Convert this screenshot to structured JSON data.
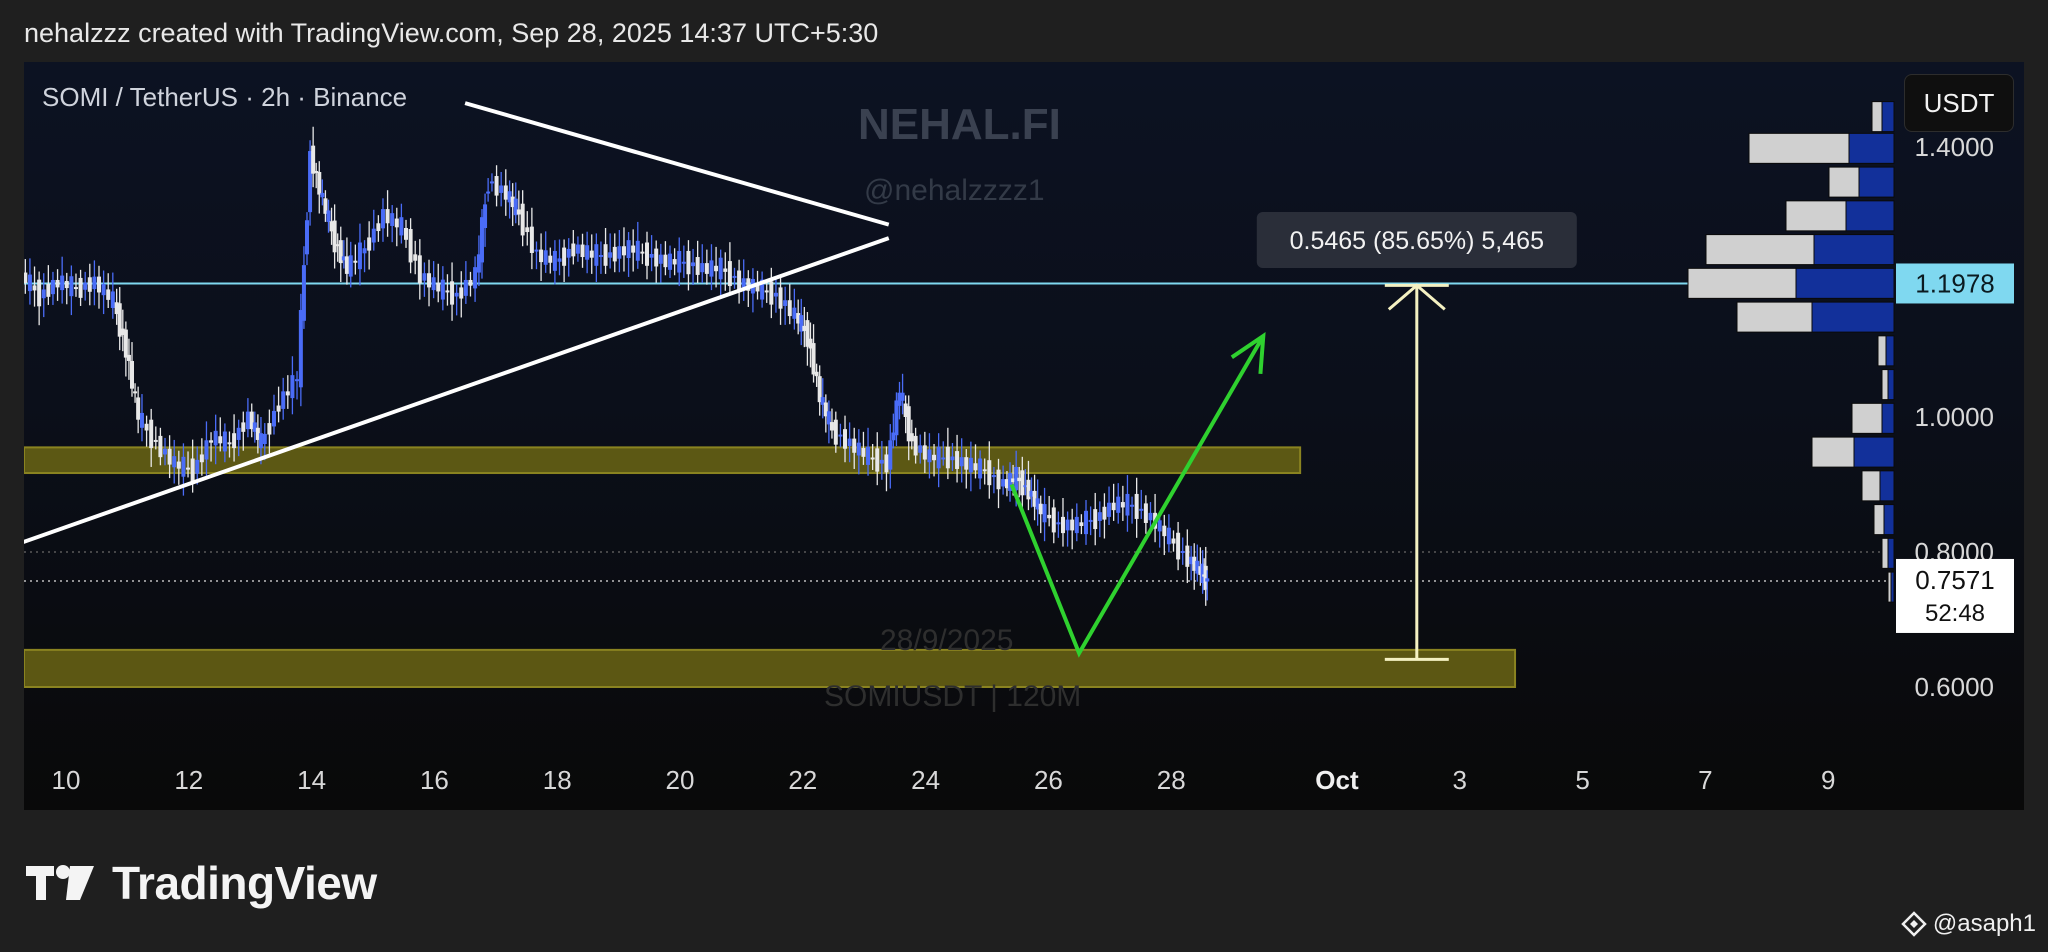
{
  "header": {
    "credit": "nehalzzz created with TradingView.com, Sep 28, 2025 14:37 UTC+5:30"
  },
  "symbol_info": "SOMI / TetherUS · 2h · Binance",
  "watermark": {
    "title": "NEHAL.FI",
    "handle": "@nehalzzzz1",
    "date": "28/9/2025",
    "symbol": "SOMIUSDT | 120M"
  },
  "toolbar": {
    "currency": "USDT"
  },
  "footer": {
    "brand": "TradingView",
    "attribution": "@asaph1"
  },
  "colors": {
    "bull": "#4a6cf7",
    "bear": "#e8e8e8",
    "zone": "#6b6514",
    "green_arrow": "#2fd12f",
    "hline": "#7fd8f0",
    "measure": "#f4f1c2",
    "vp_buy": "#12309a",
    "vp_sell": "#d0d0d0"
  },
  "chart_data": {
    "type": "candlestick",
    "x_ticks": [
      "10",
      "12",
      "14",
      "16",
      "18",
      "20",
      "22",
      "24",
      "26",
      "28",
      "Oct",
      "3",
      "5",
      "7",
      "9"
    ],
    "y_ticks": [
      "1.4000",
      "1.0000",
      "0.8000",
      "0.6000"
    ],
    "ylim": [
      0.52,
      1.48
    ],
    "grid": false,
    "close_series": [
      [
        9.1,
        1.25
      ],
      [
        9.3,
        1.21
      ],
      [
        9.6,
        1.18
      ],
      [
        9.9,
        1.2
      ],
      [
        10.2,
        1.19
      ],
      [
        10.5,
        1.2
      ],
      [
        10.8,
        1.17
      ],
      [
        11.0,
        1.1
      ],
      [
        11.2,
        1.0
      ],
      [
        11.5,
        0.96
      ],
      [
        11.8,
        0.93
      ],
      [
        12.1,
        0.92
      ],
      [
        12.4,
        0.97
      ],
      [
        12.7,
        0.96
      ],
      [
        13.0,
        1.0
      ],
      [
        13.2,
        0.96
      ],
      [
        13.5,
        1.02
      ],
      [
        13.8,
        1.06
      ],
      [
        14.0,
        1.39
      ],
      [
        14.2,
        1.32
      ],
      [
        14.4,
        1.26
      ],
      [
        14.6,
        1.22
      ],
      [
        14.9,
        1.25
      ],
      [
        15.2,
        1.3
      ],
      [
        15.5,
        1.28
      ],
      [
        15.8,
        1.21
      ],
      [
        16.1,
        1.19
      ],
      [
        16.4,
        1.18
      ],
      [
        16.7,
        1.21
      ],
      [
        16.9,
        1.35
      ],
      [
        17.2,
        1.33
      ],
      [
        17.4,
        1.3
      ],
      [
        17.7,
        1.24
      ],
      [
        18.0,
        1.23
      ],
      [
        18.3,
        1.25
      ],
      [
        18.6,
        1.24
      ],
      [
        18.9,
        1.24
      ],
      [
        19.2,
        1.25
      ],
      [
        19.5,
        1.24
      ],
      [
        19.8,
        1.23
      ],
      [
        20.1,
        1.23
      ],
      [
        20.4,
        1.22
      ],
      [
        20.7,
        1.22
      ],
      [
        21.0,
        1.2
      ],
      [
        21.3,
        1.19
      ],
      [
        21.6,
        1.18
      ],
      [
        21.9,
        1.15
      ],
      [
        22.1,
        1.12
      ],
      [
        22.3,
        1.03
      ],
      [
        22.5,
        0.98
      ],
      [
        22.8,
        0.96
      ],
      [
        23.1,
        0.94
      ],
      [
        23.4,
        0.93
      ],
      [
        23.6,
        1.04
      ],
      [
        23.8,
        0.96
      ],
      [
        24.1,
        0.94
      ],
      [
        24.4,
        0.94
      ],
      [
        24.7,
        0.93
      ],
      [
        25.0,
        0.92
      ],
      [
        25.3,
        0.9
      ],
      [
        25.5,
        0.91
      ],
      [
        25.7,
        0.89
      ],
      [
        25.9,
        0.86
      ],
      [
        26.2,
        0.84
      ],
      [
        26.5,
        0.84
      ],
      [
        26.8,
        0.85
      ],
      [
        27.1,
        0.87
      ],
      [
        27.4,
        0.87
      ],
      [
        27.7,
        0.85
      ],
      [
        28.0,
        0.82
      ],
      [
        28.3,
        0.79
      ],
      [
        28.5,
        0.77
      ],
      [
        28.6,
        0.757
      ]
    ],
    "trendlines": [
      {
        "x1": 9.0,
        "y1": 0.805,
        "x2": 23.4,
        "y2": 1.265
      },
      {
        "x1": 16.5,
        "y1": 1.465,
        "x2": 23.4,
        "y2": 1.285
      }
    ],
    "zones": [
      {
        "x1": 9.0,
        "x2": 30.1,
        "y1": 0.917,
        "y2": 0.955
      },
      {
        "x1": 9.0,
        "x2": 33.6,
        "y1": 0.6,
        "y2": 0.655
      }
    ],
    "horizontal_line": {
      "value": 1.1978,
      "label": "1.1978"
    },
    "current_price": {
      "value": 0.7571,
      "label": "0.7571",
      "countdown": "52:48"
    },
    "path_projection": [
      [
        25.4,
        0.9
      ],
      [
        26.5,
        0.65
      ],
      [
        29.5,
        1.12
      ]
    ],
    "measure": {
      "x": 32.0,
      "from": 0.641,
      "to": 1.195,
      "label": "0.5465 (85.65%) 5,465"
    },
    "volume_profile": [
      {
        "price": 1.445,
        "buy": 12,
        "sell": 10
      },
      {
        "price": 1.398,
        "buy": 45,
        "sell": 100
      },
      {
        "price": 1.348,
        "buy": 35,
        "sell": 30
      },
      {
        "price": 1.298,
        "buy": 48,
        "sell": 60
      },
      {
        "price": 1.248,
        "buy": 80,
        "sell": 108
      },
      {
        "price": 1.198,
        "buy": 98,
        "sell": 108
      },
      {
        "price": 1.148,
        "buy": 82,
        "sell": 75
      },
      {
        "price": 1.098,
        "buy": 8,
        "sell": 8
      },
      {
        "price": 1.048,
        "buy": 6,
        "sell": 6
      },
      {
        "price": 0.998,
        "buy": 12,
        "sell": 30
      },
      {
        "price": 0.948,
        "buy": 40,
        "sell": 42
      },
      {
        "price": 0.898,
        "buy": 14,
        "sell": 18
      },
      {
        "price": 0.848,
        "buy": 10,
        "sell": 10
      },
      {
        "price": 0.798,
        "buy": 6,
        "sell": 6
      },
      {
        "price": 0.748,
        "buy": 3,
        "sell": 3
      }
    ]
  }
}
